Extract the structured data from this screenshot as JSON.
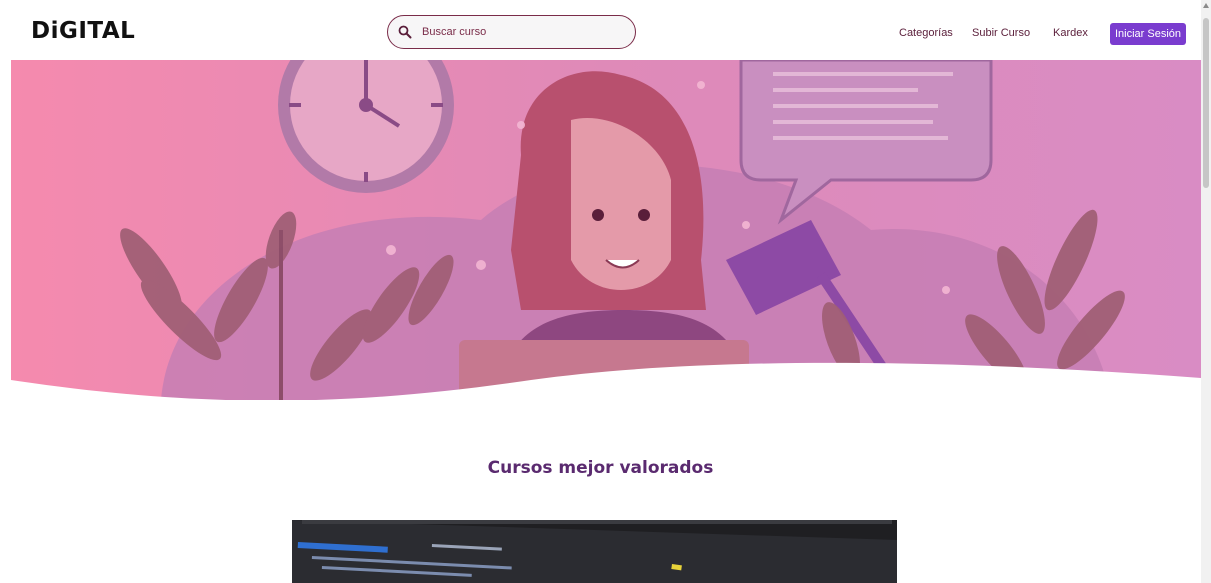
{
  "brand": {
    "logo": "DiGITAL"
  },
  "search": {
    "placeholder": "Buscar curso",
    "icon": "search-icon"
  },
  "nav": {
    "items": [
      {
        "label": "Categorías"
      },
      {
        "label": "Subir Curso"
      },
      {
        "label": "Kardex"
      }
    ],
    "login_label": "Iniciar Sesión"
  },
  "section": {
    "title": "Cursos mejor valorados"
  },
  "colors": {
    "accent": "#7a3ccf",
    "brand_dark": "#5a2a6f",
    "hero_pink": "#f08cb0"
  }
}
